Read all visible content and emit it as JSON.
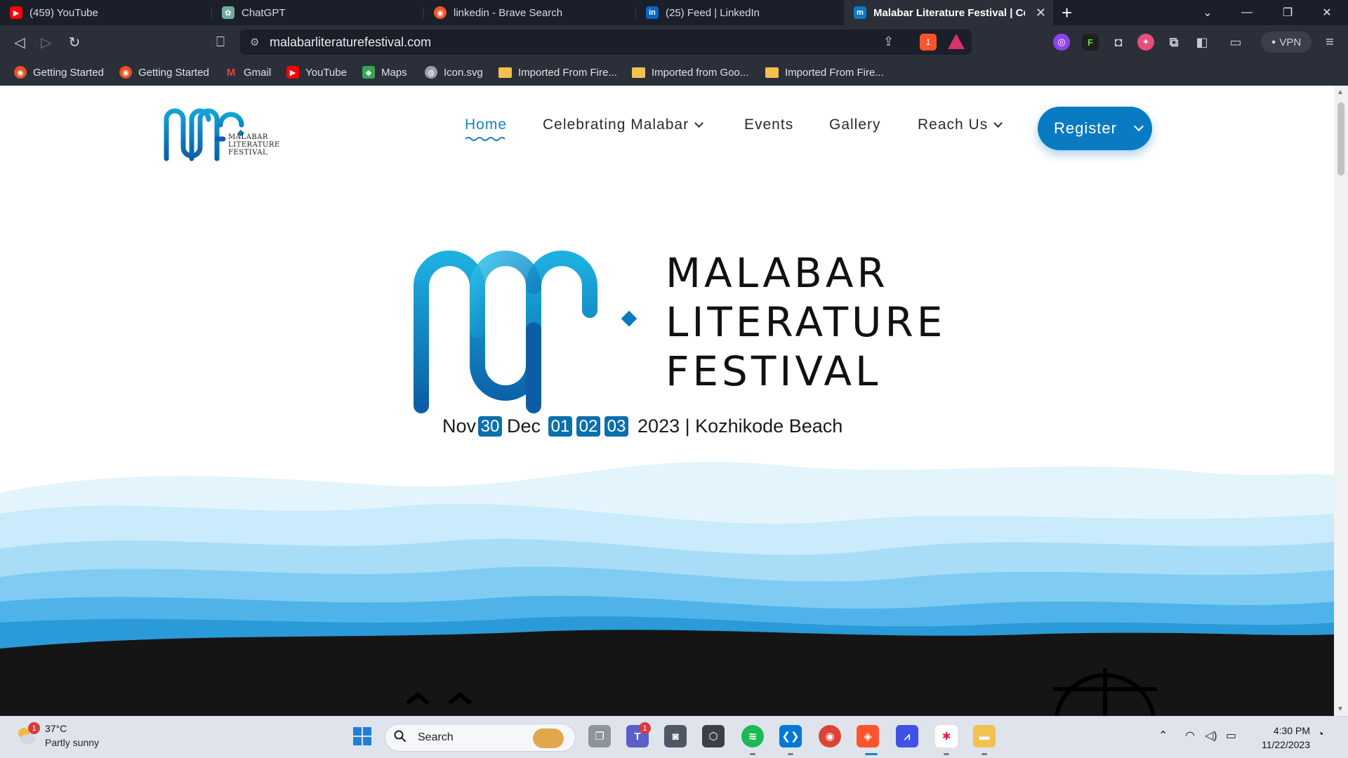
{
  "browser": {
    "tabs": [
      {
        "title": "(459) YouTube",
        "icon": "youtube-icon",
        "color": "#ff0000"
      },
      {
        "title": "ChatGPT",
        "icon": "chatgpt-icon",
        "color": "#74aa9c"
      },
      {
        "title": "linkedin - Brave Search",
        "icon": "brave-search-icon",
        "color": "#fb542b"
      },
      {
        "title": "(25) Feed | LinkedIn",
        "icon": "linkedin-icon",
        "color": "#0a66c2"
      },
      {
        "title": "Malabar Literature Festival | Cele",
        "icon": "mlf-icon",
        "color": "#0a7bc2",
        "active": true
      }
    ],
    "url": "malabarliteraturefestival.com",
    "vpn_label": "VPN",
    "shield_count": "1",
    "bookmarks": [
      {
        "label": "Getting Started",
        "icon": "firefox-icon"
      },
      {
        "label": "Getting Started",
        "icon": "firefox-icon"
      },
      {
        "label": "Gmail",
        "icon": "gmail-icon"
      },
      {
        "label": "YouTube",
        "icon": "youtube-icon"
      },
      {
        "label": "Maps",
        "icon": "maps-icon"
      },
      {
        "label": "Icon.svg",
        "icon": "globe-icon"
      },
      {
        "label": "Imported From Fire...",
        "icon": "folder-icon"
      },
      {
        "label": "Imported from Goo...",
        "icon": "folder-icon"
      },
      {
        "label": "Imported From Fire...",
        "icon": "folder-icon"
      }
    ]
  },
  "site": {
    "logo_text": [
      "MALABAR",
      "LITERATURE",
      "FESTIVAL"
    ],
    "nav": {
      "home": "Home",
      "celebrating": "Celebrating Malabar",
      "events": "Events",
      "gallery": "Gallery",
      "reach": "Reach Us",
      "register": "Register"
    },
    "hero": {
      "title_lines": [
        "MALABAR",
        "LITERATURE",
        "FESTIVAL"
      ],
      "month1": "Nov",
      "day1": "30",
      "month2": "Dec",
      "day2": "01",
      "day3": "02",
      "day4": "03",
      "year_place": "2023 | Kozhikode Beach"
    },
    "colors": {
      "accent": "#0a7bc2",
      "nav_active": "#1a7fc1",
      "date_box": "#0c6fae"
    }
  },
  "taskbar": {
    "weather_temp": "37°C",
    "weather_desc": "Partly sunny",
    "weather_badge": "1",
    "search_label": "Search",
    "teams_badge": "1",
    "time": "4:30 PM",
    "date": "11/22/2023"
  }
}
